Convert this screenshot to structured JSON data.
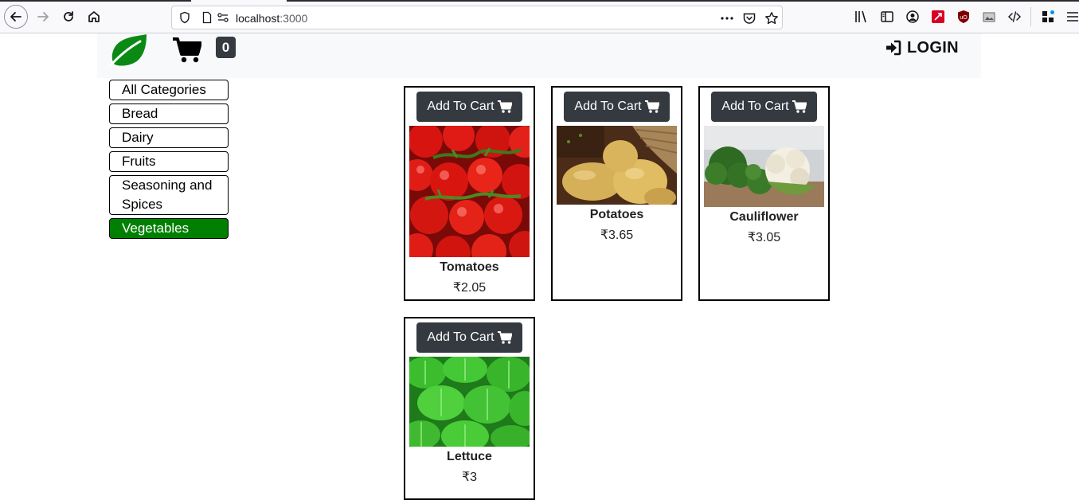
{
  "browser": {
    "url_host": "localhost",
    "url_port": ":3000"
  },
  "header": {
    "cart_count": "0",
    "login_label": "LOGIN"
  },
  "categories": [
    {
      "label": "All Categories",
      "active": false
    },
    {
      "label": "Bread",
      "active": false
    },
    {
      "label": "Dairy",
      "active": false
    },
    {
      "label": "Fruits",
      "active": false
    },
    {
      "label": "Seasoning and Spices",
      "active": false
    },
    {
      "label": "Vegetables",
      "active": true
    }
  ],
  "products": [
    {
      "name": "Tomatoes",
      "price": "₹2.05",
      "add_label": "Add To Cart",
      "image": "tomatoes"
    },
    {
      "name": "Potatoes",
      "price": "₹3.65",
      "add_label": "Add To Cart",
      "image": "potatoes"
    },
    {
      "name": "Cauliflower",
      "price": "₹3.05",
      "add_label": "Add To Cart",
      "image": "cauliflower"
    },
    {
      "name": "Lettuce",
      "price": "₹3",
      "add_label": "Add To Cart",
      "image": "lettuce"
    }
  ],
  "colors": {
    "active_category": "#008000",
    "button_dark": "#343a40",
    "navbar_bg": "#f8f9fa"
  }
}
